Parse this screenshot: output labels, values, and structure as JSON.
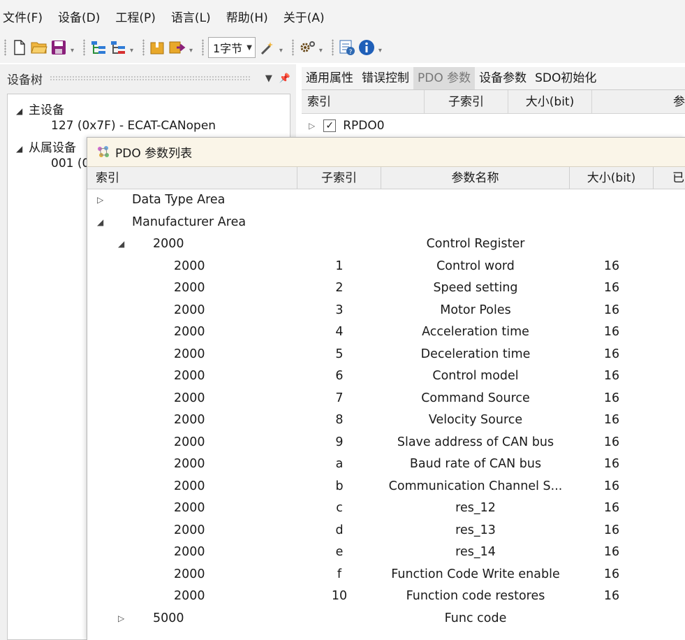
{
  "menu": {
    "items": [
      "文件(F)",
      "设备(D)",
      "工程(P)",
      "语言(L)",
      "帮助(H)",
      "关于(A)"
    ]
  },
  "toolbar": {
    "byte_select": "1字节"
  },
  "device_tree": {
    "title": "设备树",
    "master_label": "主设备",
    "master_child": "127 (0x7F)  -  ECAT-CANopen",
    "slave_label": "从属设备",
    "slave_child": "001 (0"
  },
  "property_tabs": [
    "通用属性",
    "错误控制",
    "PDO 参数",
    "设备参数",
    "SDO初始化"
  ],
  "pdo_grid": {
    "headers": [
      "索引",
      "子索引",
      "大小(bit)",
      "参"
    ],
    "row_label": "RPDO0",
    "row_checked": true
  },
  "dialog": {
    "title": "PDO 参数列表",
    "headers": {
      "index": "索引",
      "subindex": "子索引",
      "name": "参数名称",
      "size": "大小(bit)",
      "extra": "已"
    },
    "groups": {
      "data_type": "Data Type Area",
      "manufacturer": "Manufacturer Area"
    },
    "parent": {
      "index": "2000",
      "name": "Control Register"
    },
    "rows": [
      {
        "index": "2000",
        "sub": "1",
        "name": "Control word",
        "size": "16"
      },
      {
        "index": "2000",
        "sub": "2",
        "name": "Speed setting",
        "size": "16"
      },
      {
        "index": "2000",
        "sub": "3",
        "name": "Motor Poles",
        "size": "16"
      },
      {
        "index": "2000",
        "sub": "4",
        "name": "Acceleration time",
        "size": "16"
      },
      {
        "index": "2000",
        "sub": "5",
        "name": "Deceleration time",
        "size": "16"
      },
      {
        "index": "2000",
        "sub": "6",
        "name": "Control model",
        "size": "16"
      },
      {
        "index": "2000",
        "sub": "7",
        "name": "Command Source",
        "size": "16"
      },
      {
        "index": "2000",
        "sub": "8",
        "name": "Velocity Source",
        "size": "16"
      },
      {
        "index": "2000",
        "sub": "9",
        "name": "Slave address of CAN bus",
        "size": "16"
      },
      {
        "index": "2000",
        "sub": "a",
        "name": "Baud rate of CAN bus",
        "size": "16"
      },
      {
        "index": "2000",
        "sub": "b",
        "name": "Communication Channel S...",
        "size": "16"
      },
      {
        "index": "2000",
        "sub": "c",
        "name": "res_12",
        "size": "16"
      },
      {
        "index": "2000",
        "sub": "d",
        "name": "res_13",
        "size": "16"
      },
      {
        "index": "2000",
        "sub": "e",
        "name": "res_14",
        "size": "16"
      },
      {
        "index": "2000",
        "sub": "f",
        "name": "Function Code Write enable",
        "size": "16"
      },
      {
        "index": "2000",
        "sub": "10",
        "name": "Function code restores",
        "size": "16"
      }
    ],
    "next_parent": {
      "index": "5000",
      "name": "Func code"
    }
  }
}
